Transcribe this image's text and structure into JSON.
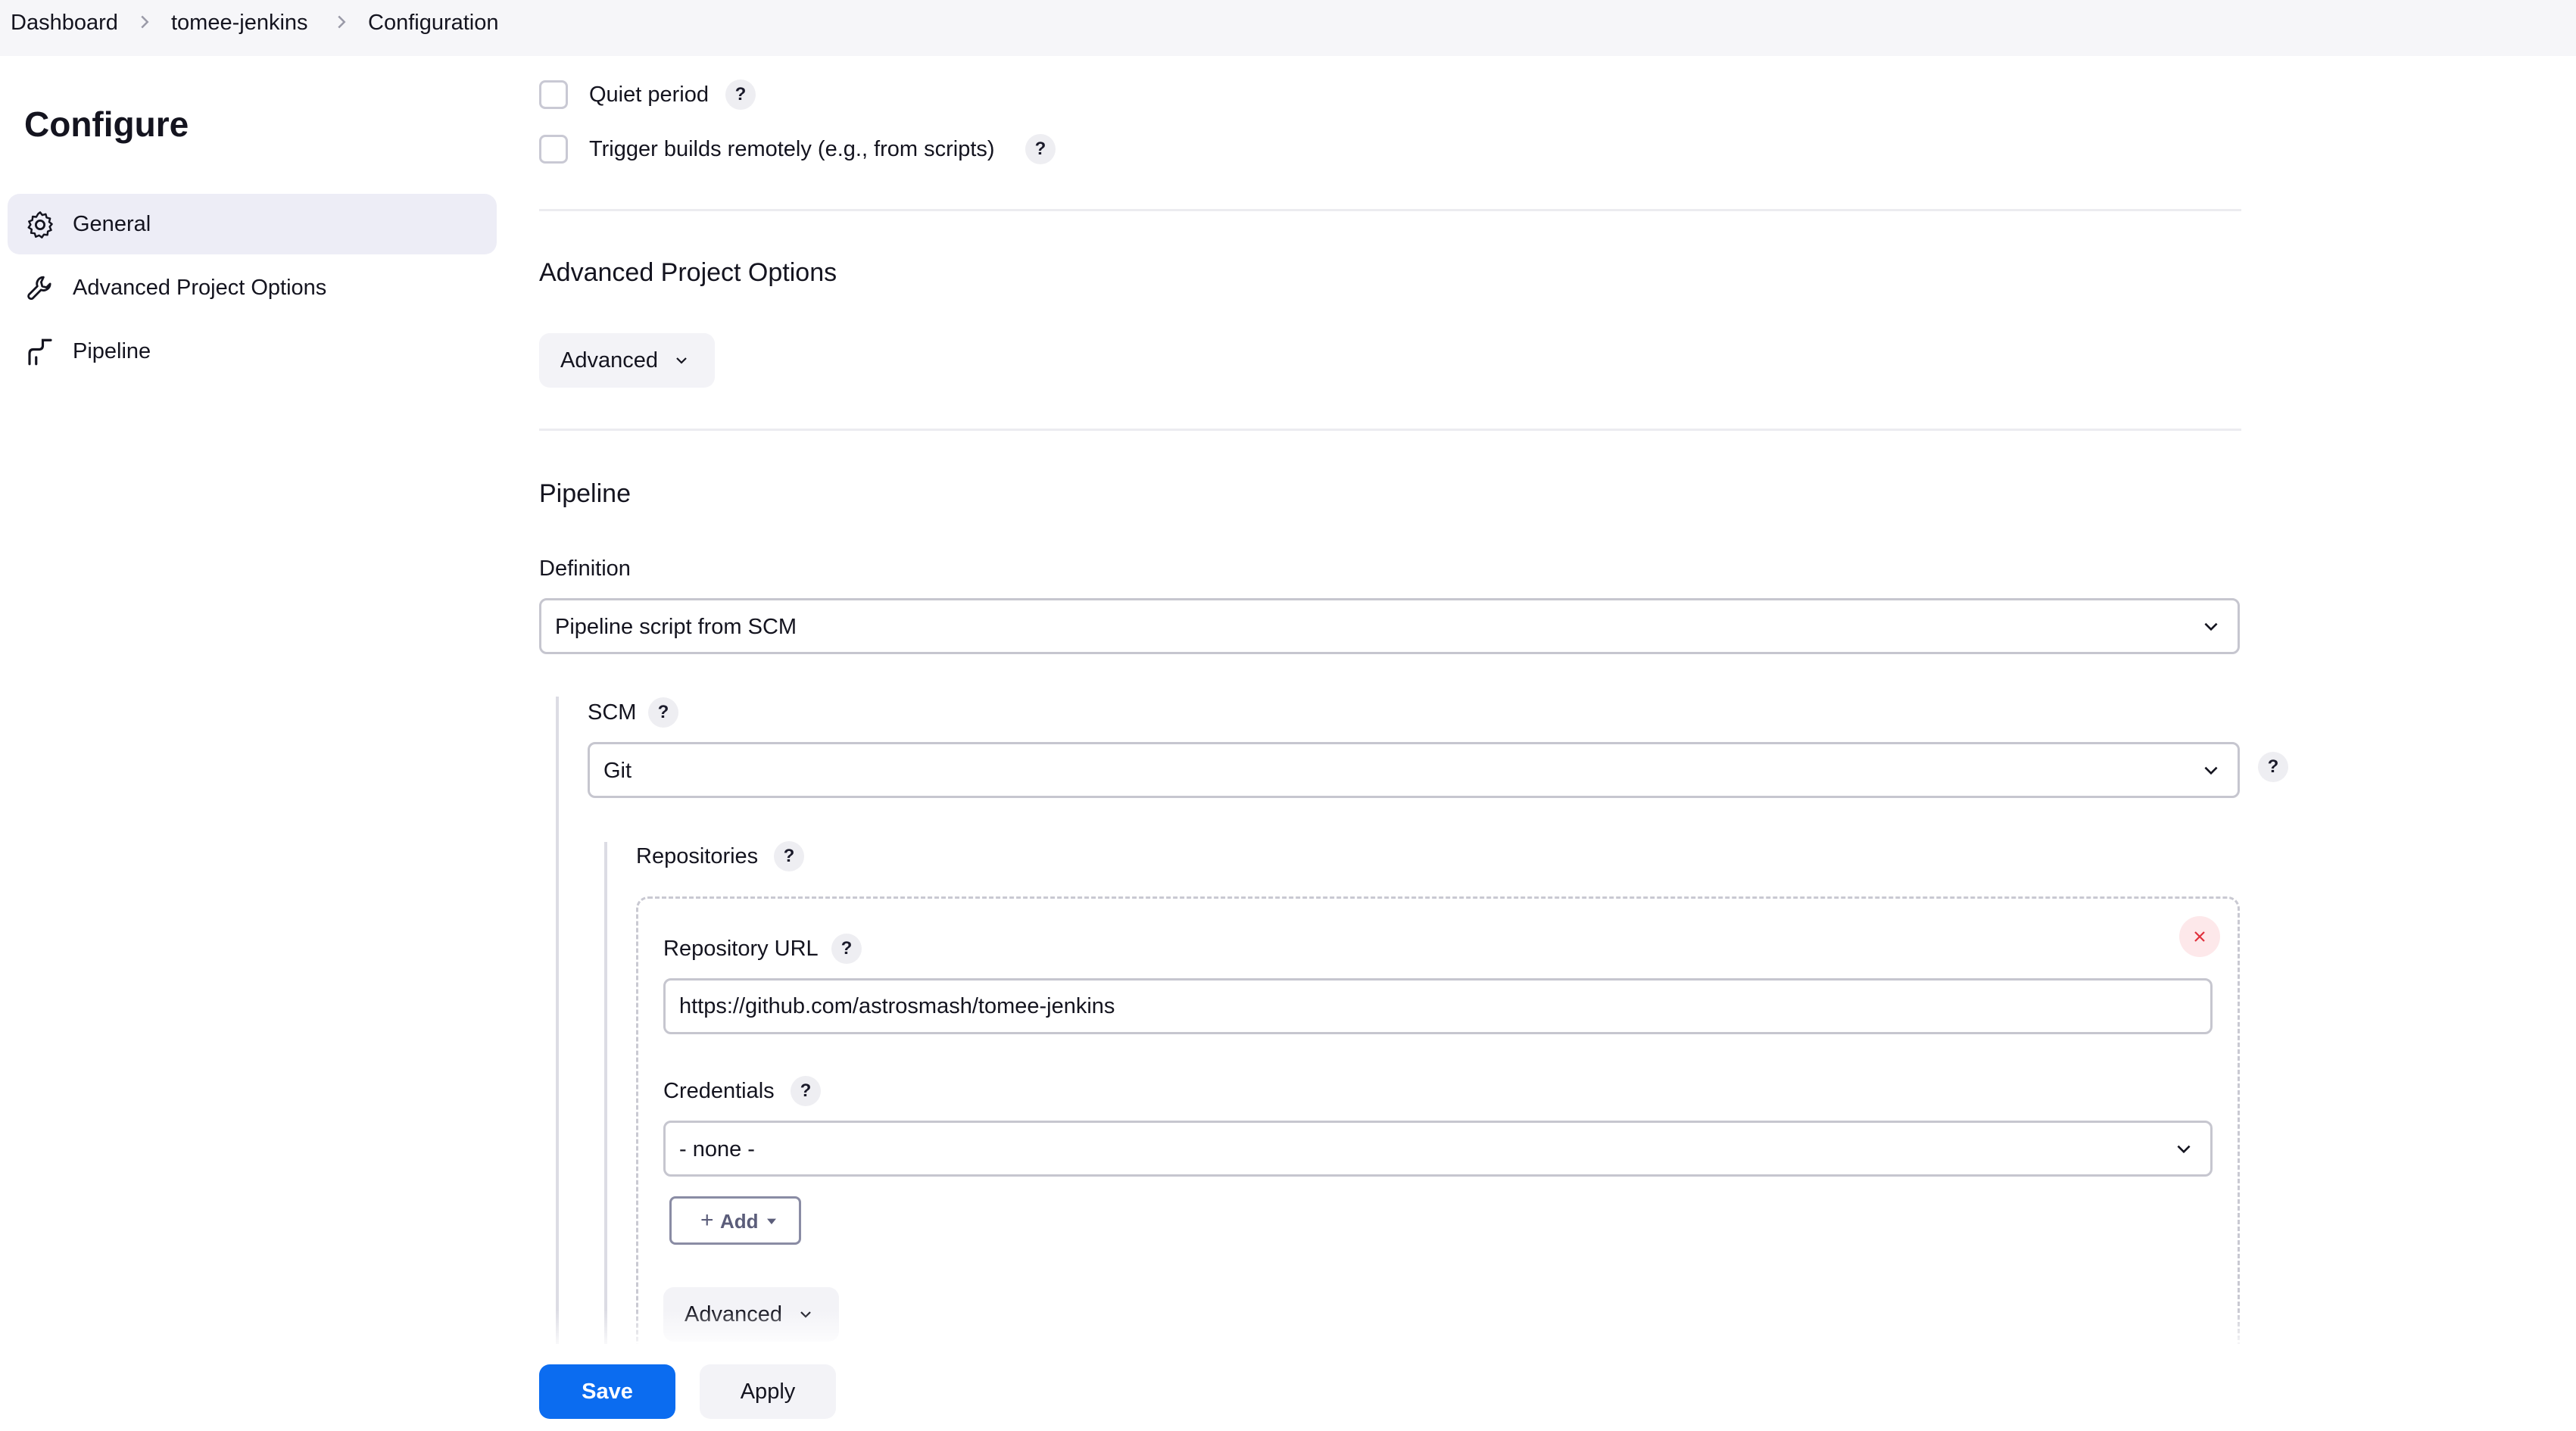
{
  "breadcrumb": {
    "items": [
      "Dashboard",
      "tomee-jenkins",
      "Configuration"
    ]
  },
  "sidebar": {
    "title": "Configure",
    "items": [
      {
        "label": "General",
        "icon": "gear-icon",
        "active": true
      },
      {
        "label": "Advanced Project Options",
        "icon": "wrench-icon",
        "active": false
      },
      {
        "label": "Pipeline",
        "icon": "pipeline-icon",
        "active": false
      }
    ]
  },
  "triggers": {
    "quiet_period": {
      "label": "Quiet period",
      "checked": false
    },
    "trigger_remote": {
      "label": "Trigger builds remotely (e.g., from scripts)",
      "checked": false
    }
  },
  "advanced_project_options": {
    "title": "Advanced Project Options",
    "advanced_label": "Advanced"
  },
  "pipeline": {
    "title": "Pipeline",
    "definition_label": "Definition",
    "definition_value": "Pipeline script from SCM",
    "scm_label": "SCM",
    "scm_value": "Git",
    "repositories_label": "Repositories",
    "repository_url_label": "Repository URL",
    "repository_url_value": "https://github.com/astrosmash/tomee-jenkins",
    "credentials_label": "Credentials",
    "credentials_value": "- none -",
    "add_label": "Add",
    "advanced_label": "Advanced"
  },
  "help_glyph": "?",
  "footer": {
    "save_label": "Save",
    "apply_label": "Apply"
  },
  "colors": {
    "primary": "#0b6cf0",
    "active_nav_bg": "#ededf6",
    "remove_icon": "#e0303c"
  }
}
